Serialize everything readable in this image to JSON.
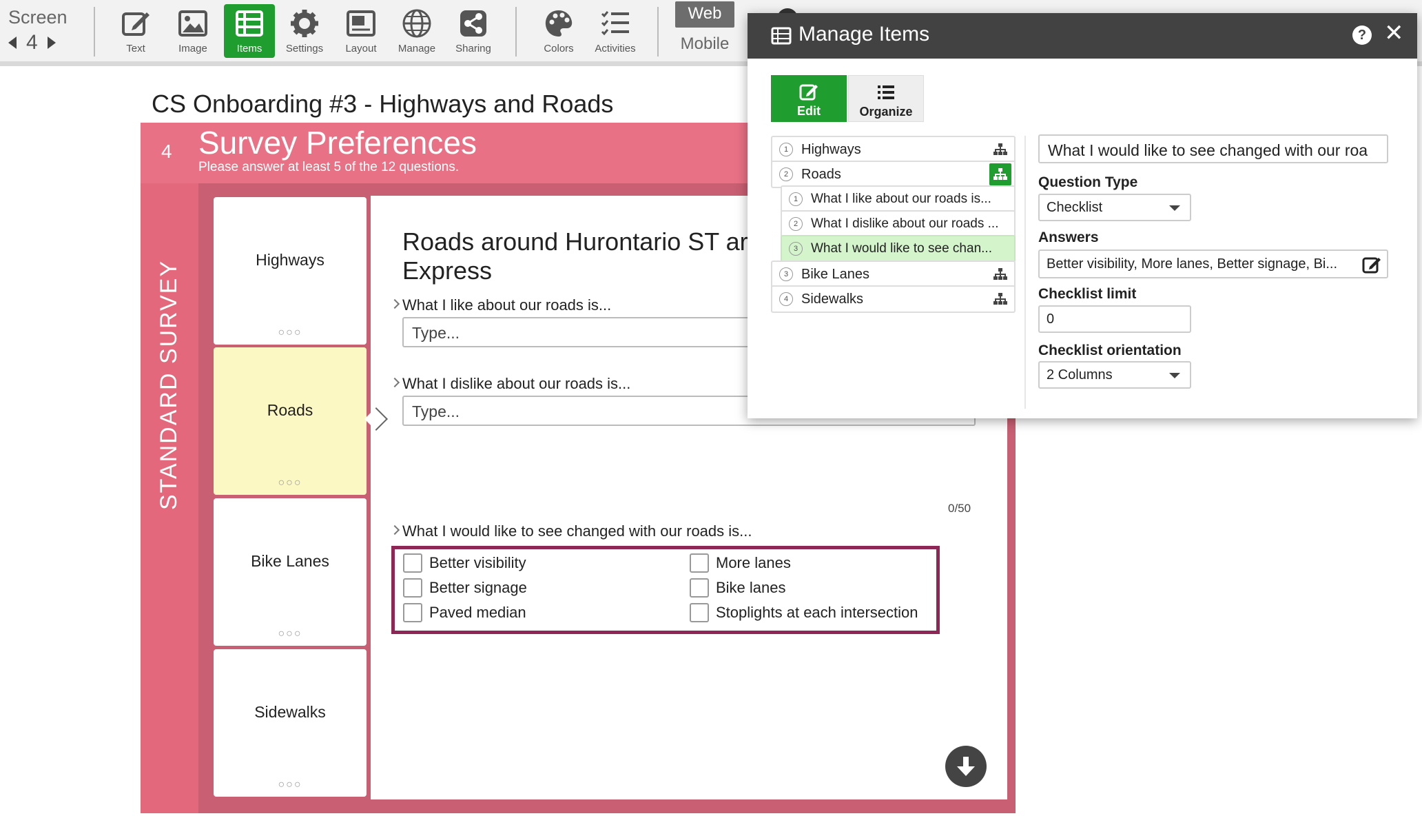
{
  "toolbar": {
    "screen_label": "Screen",
    "screen_number": "4",
    "tools": [
      {
        "label": "Text",
        "icon": "edit-icon"
      },
      {
        "label": "Image",
        "icon": "image-icon"
      },
      {
        "label": "Items",
        "icon": "items-icon",
        "active": true
      },
      {
        "label": "Settings",
        "icon": "gear-icon"
      },
      {
        "label": "Layout",
        "icon": "layout-icon"
      },
      {
        "label": "Manage",
        "icon": "globe-icon"
      },
      {
        "label": "Sharing",
        "icon": "share-icon"
      },
      {
        "label": "Colors",
        "icon": "palette-icon"
      },
      {
        "label": "Activities",
        "icon": "list-check-icon"
      }
    ],
    "view_web": "Web",
    "view_mobile": "Mobile"
  },
  "page": {
    "title": "CS Onboarding #3 - Highways and Roads"
  },
  "survey": {
    "screen_number": "4",
    "title": "Survey Preferences",
    "subtitle": "Please answer at least 5 of the 12 questions.",
    "side_label": "STANDARD SURVEY",
    "tiles": [
      {
        "name": "Highways",
        "dots": "○○○"
      },
      {
        "name": "Roads",
        "dots": "○○○",
        "selected": true
      },
      {
        "name": "Bike Lanes",
        "dots": "○○○"
      },
      {
        "name": "Sidewalks",
        "dots": "○○○"
      }
    ],
    "content": {
      "heading_line1": "Roads around Hurontario ST ar",
      "heading_line2": "Express",
      "q1": "What I like about our roads is...",
      "q1_placeholder": "Type...",
      "q2": "What I dislike about our roads is...",
      "q2_placeholder": "Type...",
      "q2_counter": "0/50",
      "q3": "What I would like to see changed with our roads is...",
      "options": [
        "Better visibility",
        "More lanes",
        "Better signage",
        "Bike lanes",
        "Paved median",
        "Stoplights at each intersection"
      ]
    }
  },
  "dialog": {
    "title": "Manage Items",
    "help": "?",
    "close": "✕",
    "mode_edit": "Edit",
    "mode_organize": "Organize",
    "tree": [
      {
        "num": "1",
        "label": "Highways"
      },
      {
        "num": "2",
        "label": "Roads"
      },
      {
        "num": "1",
        "label": "What I like about our roads is..."
      },
      {
        "num": "2",
        "label": "What I dislike about our roads ..."
      },
      {
        "num": "3",
        "label": "What I would like to see chan..."
      },
      {
        "num": "3",
        "label": "Bike Lanes"
      },
      {
        "num": "4",
        "label": "Sidewalks"
      }
    ],
    "editor": {
      "title_value": "What I would like to see changed with our roa",
      "question_type_label": "Question Type",
      "question_type_value": "Checklist",
      "answers_label": "Answers",
      "answers_value": "Better visibility, More lanes, Better signage, Bi...",
      "checklist_limit_label": "Checklist limit",
      "checklist_limit_value": "0",
      "orientation_label": "Checklist orientation",
      "orientation_value": "2 Columns"
    }
  },
  "colors": {
    "accent_green": "#1f9e2f",
    "survey_pink": "#e97185",
    "dialog_header": "#424242",
    "highlight_border": "#8e2656"
  }
}
